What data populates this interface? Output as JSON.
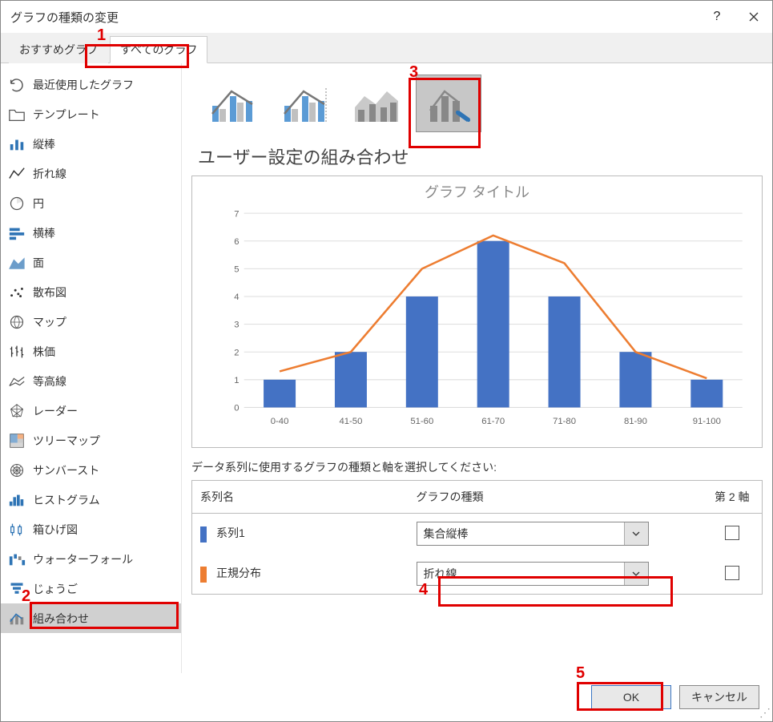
{
  "title": "グラフの種類の変更",
  "tabs": [
    {
      "label": "おすすめグラフ",
      "active": false
    },
    {
      "label": "すべてのグラフ",
      "active": true
    }
  ],
  "sidebar": {
    "items": [
      {
        "label": "最近使用したグラフ",
        "icon": "undo"
      },
      {
        "label": "テンプレート",
        "icon": "folder"
      },
      {
        "label": "縦棒",
        "icon": "column"
      },
      {
        "label": "折れ線",
        "icon": "line"
      },
      {
        "label": "円",
        "icon": "pie"
      },
      {
        "label": "横棒",
        "icon": "bar"
      },
      {
        "label": "面",
        "icon": "area"
      },
      {
        "label": "散布図",
        "icon": "scatter"
      },
      {
        "label": "マップ",
        "icon": "map"
      },
      {
        "label": "株価",
        "icon": "stock"
      },
      {
        "label": "等高線",
        "icon": "surface"
      },
      {
        "label": "レーダー",
        "icon": "radar"
      },
      {
        "label": "ツリーマップ",
        "icon": "treemap"
      },
      {
        "label": "サンバースト",
        "icon": "sunburst"
      },
      {
        "label": "ヒストグラム",
        "icon": "histogram"
      },
      {
        "label": "箱ひげ図",
        "icon": "boxwhisker"
      },
      {
        "label": "ウォーターフォール",
        "icon": "waterfall"
      },
      {
        "label": "じょうご",
        "icon": "funnel"
      },
      {
        "label": "組み合わせ",
        "icon": "combo"
      }
    ],
    "selected_index": 18
  },
  "subtypes": {
    "items": [
      "clustered-column-line",
      "clustered-column-line-secondary",
      "stacked-area-column",
      "custom-combination"
    ],
    "selected_index": 3
  },
  "section_title": "ユーザー設定の組み合わせ",
  "preview": {
    "title": "グラフ タイトル"
  },
  "series_section_label": "データ系列に使用するグラフの種類と軸を選択してください:",
  "series_table": {
    "headers": {
      "name": "系列名",
      "type": "グラフの種類",
      "secondary": "第 2 軸"
    },
    "rows": [
      {
        "name": "系列1",
        "color": "#4472c4",
        "type": "集合縦棒",
        "secondary": false
      },
      {
        "name": "正規分布",
        "color": "#ed7d31",
        "type": "折れ線",
        "secondary": false
      }
    ]
  },
  "buttons": {
    "ok": "OK",
    "cancel": "キャンセル"
  },
  "annotations": {
    "1": "1",
    "2": "2",
    "3": "3",
    "4": "4",
    "5": "5"
  },
  "chart_data": {
    "type": "combo",
    "title": "グラフ タイトル",
    "categories": [
      "0-40",
      "41-50",
      "51-60",
      "61-70",
      "71-80",
      "81-90",
      "91-100"
    ],
    "series": [
      {
        "name": "系列1",
        "type": "bar",
        "color": "#4472c4",
        "values": [
          1,
          2,
          4,
          6,
          4,
          2,
          1
        ]
      },
      {
        "name": "正規分布",
        "type": "line",
        "color": "#ed7d31",
        "values": [
          1.3,
          2,
          5,
          6.2,
          5.2,
          2,
          1.05
        ]
      }
    ],
    "ylabel": "",
    "xlabel": "",
    "ylim": [
      0,
      7
    ],
    "yticks": [
      0,
      1,
      2,
      3,
      4,
      5,
      6,
      7
    ]
  }
}
